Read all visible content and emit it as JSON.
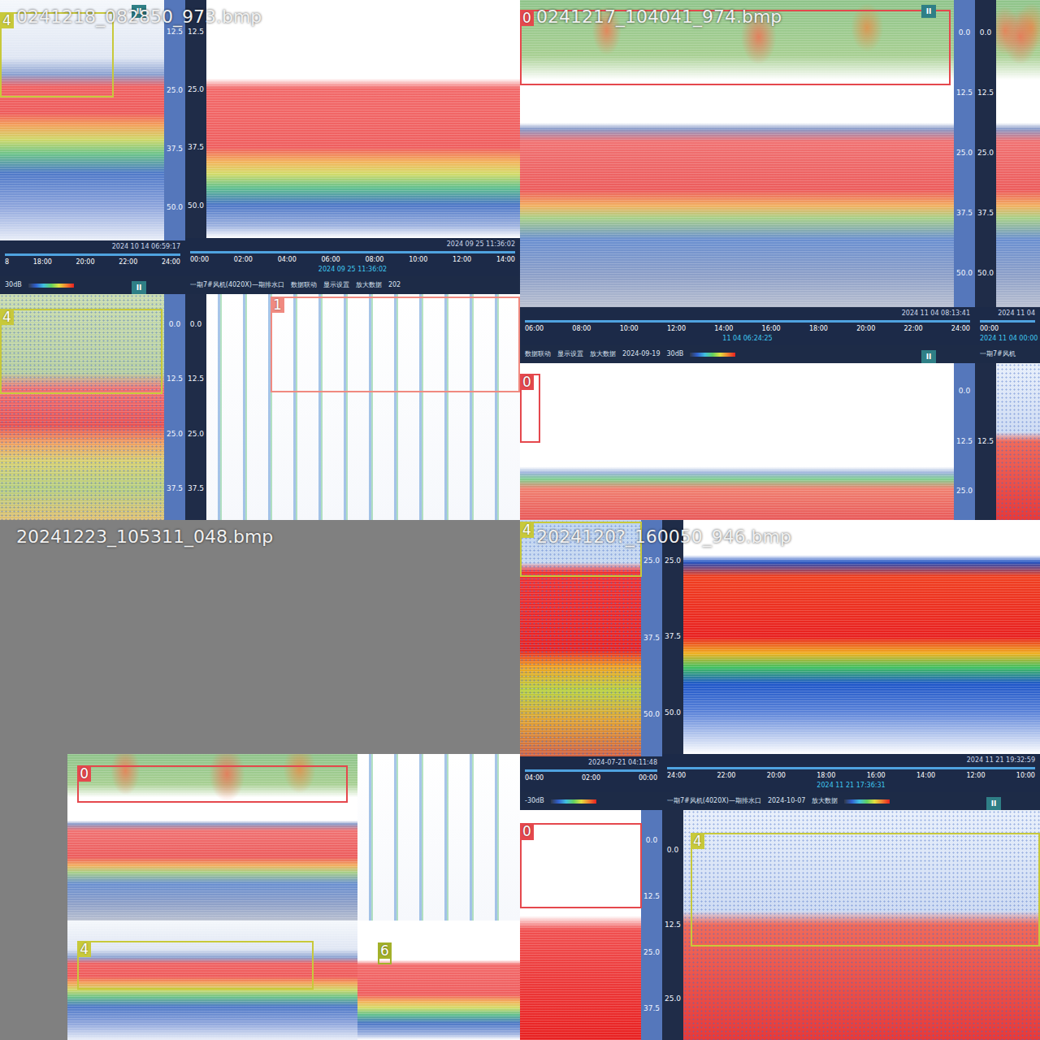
{
  "mosaic": [
    {
      "filename": "0241218_082850_973.bmp",
      "tiles": [
        {
          "kind": "surface-high",
          "badge": "II",
          "axis": {
            "side": "right",
            "ticks": [
              "12.5",
              "25.0",
              "37.5",
              "50.0"
            ]
          },
          "timeline": {
            "date": "2024 10 14 06:59:17",
            "ticks": [
              "8",
              "18:00",
              "20:00",
              "22:00",
              "24:00"
            ]
          },
          "boxes": [
            {
              "label": "4",
              "color": "#c8c93a",
              "region": [
                0,
                0.044,
                0.614,
                0.309
              ]
            }
          ]
        },
        {
          "kind": "surface-low",
          "axis": {
            "side": "left",
            "ticks": [
              "12.5",
              "25.0",
              "37.5",
              "50.0"
            ]
          },
          "timeline": {
            "date": "2024 09 25 11:36:02",
            "ticks": [
              "00:00",
              "02:00",
              "04:00",
              "06:00",
              "08:00",
              "10:00",
              "12:00",
              "14:00"
            ],
            "cursor": "2024 09 25 11:36:02"
          },
          "boxes": []
        },
        {
          "kind": "dense",
          "badge": "II",
          "toolbar": {
            "items": [
              "30dB"
            ],
            "scale": true
          },
          "axis": {
            "side": "right",
            "ticks": [
              "0.0",
              "12.5",
              "25.0",
              "37.5"
            ]
          },
          "boxes": [
            {
              "label": "4",
              "color": "#c8c93a",
              "region": [
                0,
                0.133,
                0.877,
                0.35
              ]
            }
          ]
        },
        {
          "kind": "sparse",
          "toolbar": {
            "items": [
              "一期7#风机(4020X)—期排水口",
              "数据联动",
              "显示设置",
              "放大数据",
              "202"
            ],
            "scale": false
          },
          "axis": {
            "side": "left",
            "ticks": [
              "0.0",
              "12.5",
              "25.0",
              "37.5"
            ]
          },
          "boxes": [
            {
              "label": "1",
              "color": "#f08a80",
              "region": [
                0.255,
                0.083,
                0.745,
                0.393
              ]
            }
          ]
        }
      ]
    },
    {
      "filename": "0241217_104041_974.bmp",
      "tiles": [
        {
          "kind": "fish-top",
          "badge": "II",
          "axis": {
            "side": "right",
            "ticks": [
              "0.0",
              "12.5",
              "25.0",
              "37.5",
              "50.0"
            ]
          },
          "timeline": {
            "date": "2024 11 04 08:13:41",
            "ticks": [
              "06:00",
              "08:00",
              "10:00",
              "12:00",
              "14:00",
              "16:00",
              "18:00",
              "20:00",
              "22:00",
              "24:00"
            ],
            "cursor": "11 04 06:24:25"
          },
          "boxes": [
            {
              "label": "0",
              "color": "#e5484d",
              "region": [
                0,
                0.028,
                0.946,
                0.219
              ]
            }
          ]
        },
        {
          "kind": "fish-top",
          "axis": {
            "side": "left",
            "ticks": [
              "0.0",
              "12.5",
              "25.0",
              "37.5",
              "50.0"
            ]
          },
          "timeline": {
            "date": "2024 11 04",
            "ticks": [
              "00:00"
            ],
            "cursor": "2024 11 04 00:00"
          },
          "boxes": []
        },
        {
          "kind": "seabed",
          "badge": "II",
          "toolbar": {
            "items": [
              "数据联动",
              "显示设置",
              "放大数据",
              "2024-09-19",
              "30dB"
            ],
            "scale": true
          },
          "axis": {
            "side": "right",
            "ticks": [
              "0.0",
              "12.5",
              "25.0"
            ]
          },
          "boxes": [
            {
              "label": "0",
              "color": "#e5484d",
              "region": [
                0,
                0.163,
                0.045,
                0.395
              ]
            }
          ]
        },
        {
          "kind": "speckle-red",
          "toolbar": {
            "items": [
              "一期7#风机"
            ],
            "scale": false
          },
          "axis": {
            "side": "left",
            "ticks": [
              "12.5"
            ]
          },
          "boxes": []
        }
      ]
    },
    {
      "filename": "20241223_105311_048.bmp",
      "tiles": [
        {
          "kind": "fish-top",
          "boxes": [
            {
              "label": "0",
              "color": "#e5484d",
              "region": [
                0.034,
                0.068,
                0.933,
                0.224
              ]
            }
          ]
        },
        {
          "kind": "sparse",
          "boxes": []
        },
        {
          "kind": "surface-high",
          "boxes": [
            {
              "label": "4",
              "color": "#c8c93a",
              "region": [
                0.034,
                0.17,
                0.815,
                0.408
              ]
            }
          ]
        },
        {
          "kind": "surface-low",
          "boxes": [
            {
              "label": "6",
              "color": "#a3b12a",
              "region": [
                0.125,
                0.184,
                0.085,
                0.184
              ]
            }
          ]
        }
      ]
    },
    {
      "filename": "2024120?_160050_946.bmp",
      "tiles": [
        {
          "kind": "bright-red",
          "axis": {
            "side": "right",
            "ticks": [
              "25.0",
              "37.5",
              "50.0"
            ]
          },
          "timeline": {
            "date": "2024-07-21 04:11:48",
            "ticks": [
              "04:00",
              "02:00",
              "00:00"
            ]
          },
          "boxes": [
            {
              "label": "4",
              "color": "#c8c93a",
              "region": [
                0,
                0.006,
                0.857,
                0.203
              ]
            }
          ]
        },
        {
          "kind": "bright-surface",
          "axis": {
            "side": "left",
            "ticks": [
              "25.0",
              "37.5",
              "50.0"
            ]
          },
          "timeline": {
            "date": "2024 11 21 19:32:59",
            "ticks": [
              "24:00",
              "22:00",
              "20:00",
              "18:00",
              "16:00",
              "14:00",
              "12:00",
              "10:00"
            ],
            "cursor": "2024 11 21 17:36:31"
          },
          "boxes": []
        },
        {
          "kind": "deep-red",
          "toolbar": {
            "items": [
              "-30dB"
            ],
            "scale": true
          },
          "axis": {
            "side": "right",
            "ticks": [
              "0.0",
              "12.5",
              "25.0",
              "37.5"
            ]
          },
          "boxes": [
            {
              "label": "0",
              "color": "#e5484d",
              "region": [
                0,
                0.125,
                0.857,
                0.344
              ]
            }
          ]
        },
        {
          "kind": "speckle-red",
          "badge": "II",
          "toolbar": {
            "items": [
              "一期7#风机(4020X)—期排水口",
              "2024-10-07",
              "放大数据"
            ],
            "scale": true
          },
          "axis": {
            "side": "left",
            "ticks": [
              "0.0",
              "12.5",
              "25.0"
            ]
          },
          "boxes": [
            {
              "label": "4",
              "color": "#c8c93a",
              "region": [
                0.075,
                0.164,
                0.925,
                0.459
              ]
            }
          ]
        }
      ]
    }
  ]
}
